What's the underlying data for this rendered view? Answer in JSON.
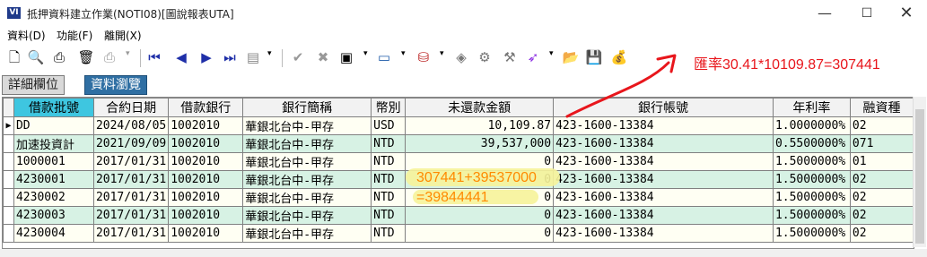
{
  "window": {
    "icon_text": "VI",
    "title": "抵押資料建立作業(NOTI08)[圖說報表UTA]",
    "minimize": "—",
    "maximize": "☐",
    "close": "✕"
  },
  "menu": [
    "資料(D)",
    "功能(F)",
    "離開(X)"
  ],
  "toolbar_icons": [
    "new-icon",
    "preview-icon",
    "print-setup-icon",
    "delete-icon",
    "print-icon",
    "first-record-icon",
    "previous-record-icon",
    "next-record-icon",
    "last-record-icon",
    "edit-icon",
    "confirm-icon",
    "cancel-icon",
    "export-icon",
    "display-icon",
    "filter-icon",
    "tag-icon",
    "tool-icon",
    "tool2-icon",
    "wand-icon",
    "folder-icon",
    "save-icon",
    "money-bag-icon"
  ],
  "tabs": {
    "details": "詳細欄位",
    "browse": "資料瀏覽"
  },
  "grid": {
    "columns": [
      "借款批號",
      "合約日期",
      "借款銀行",
      "銀行簡稱",
      "幣別",
      "未還款金額",
      "銀行帳號",
      "年利率",
      "融資種"
    ],
    "rows": [
      {
        "ind": "▶",
        "batch": "DD",
        "date": "2024/08/05",
        "bank": "1002010",
        "bank_name": "華銀北台中-甲存",
        "currency": "USD",
        "amount": "10,109.87",
        "account": "423-1600-13384",
        "rate": "1.0000000%",
        "type": "02"
      },
      {
        "ind": "",
        "batch": "加速投資計",
        "date": "2021/09/09",
        "bank": "1002010",
        "bank_name": "華銀北台中-甲存",
        "currency": "NTD",
        "amount": "39,537,000",
        "account": "423-1600-13384",
        "rate": "0.5500000%",
        "type": "071"
      },
      {
        "ind": "",
        "batch": "1000001",
        "date": "2017/01/31",
        "bank": "1002010",
        "bank_name": "華銀北台中-甲存",
        "currency": "NTD",
        "amount": "0",
        "account": "423-1600-13384",
        "rate": "1.5000000%",
        "type": "01"
      },
      {
        "ind": "",
        "batch": "4230001",
        "date": "2017/01/31",
        "bank": "1002010",
        "bank_name": "華銀北台中-甲存",
        "currency": "NTD",
        "amount": "0",
        "account": "423-1600-13384",
        "rate": "1.5000000%",
        "type": "02"
      },
      {
        "ind": "",
        "batch": "4230002",
        "date": "2017/01/31",
        "bank": "1002010",
        "bank_name": "華銀北台中-甲存",
        "currency": "NTD",
        "amount": "0",
        "account": "423-1600-13384",
        "rate": "1.5000000%",
        "type": "02"
      },
      {
        "ind": "",
        "batch": "4230003",
        "date": "2017/01/31",
        "bank": "1002010",
        "bank_name": "華銀北台中-甲存",
        "currency": "NTD",
        "amount": "0",
        "account": "423-1600-13384",
        "rate": "1.5000000%",
        "type": "02"
      },
      {
        "ind": "",
        "batch": "4230004",
        "date": "2017/01/31",
        "bank": "1002010",
        "bank_name": "華銀北台中-甲存",
        "currency": "NTD",
        "amount": "0",
        "account": "423-1600-13384",
        "rate": "1.5000000%",
        "type": "02"
      }
    ]
  },
  "annotations": {
    "exchange_rate": "匯率30.41*10109.87=307441",
    "sum": "307441+39537000",
    "total": "=39844441",
    "color_red": "#e8161c",
    "color_orange": "#ff8a00",
    "color_highlight": "#f6f39a"
  }
}
